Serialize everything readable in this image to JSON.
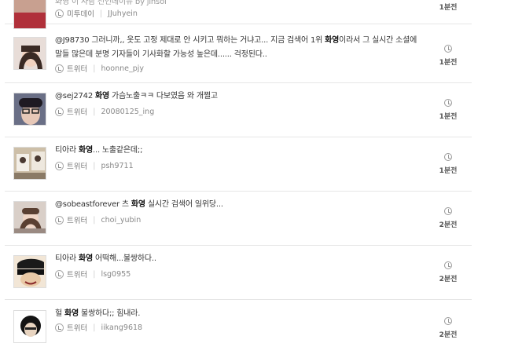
{
  "feed": {
    "items": [
      {
        "text_parts": [
          "화영 이 사람 전인데이뉴 by jinsol"
        ],
        "source": "미투데이",
        "user": "JJuhyein",
        "time": "1분전"
      },
      {
        "text_parts": [
          "@J98730 그러니까,, 옷도 고정 제대로 안 시키고 뭐하는 거냐고... 지금 검색어 1위 ",
          "화영",
          "이라서 그 실시간 소셜에 말들 많은데 분명 기자들이 기사화할 가능성 높은데...... 걱정된다.."
        ],
        "source": "트위터",
        "user": "hoonne_pjy",
        "time": "1분전"
      },
      {
        "text_parts": [
          "@sej2742 ",
          "화영",
          " 가슴노출ㅋㅋ 다보였음 와 개쩔고"
        ],
        "source": "트위터",
        "user": "20080125_ing",
        "time": "1분전"
      },
      {
        "text_parts": [
          "티아라 ",
          "화영",
          "... 노출같은데;;"
        ],
        "source": "트위터",
        "user": "psh9711",
        "time": "1분전"
      },
      {
        "text_parts": [
          "@sobeastforever 츠 ",
          "화영",
          " 실시간 검색어 일위당..."
        ],
        "source": "트위터",
        "user": "choi_yubin",
        "time": "2분전"
      },
      {
        "text_parts": [
          "티아라 ",
          "화영",
          " 어떡해...불쌍하다.."
        ],
        "source": "트위터",
        "user": "lsg0955",
        "time": "2분전"
      },
      {
        "text_parts": [
          "헐 ",
          "화영",
          " 불쌍하다;; 힘내라."
        ],
        "source": "트위터",
        "user": "iikang9618",
        "time": "2분전"
      }
    ]
  }
}
